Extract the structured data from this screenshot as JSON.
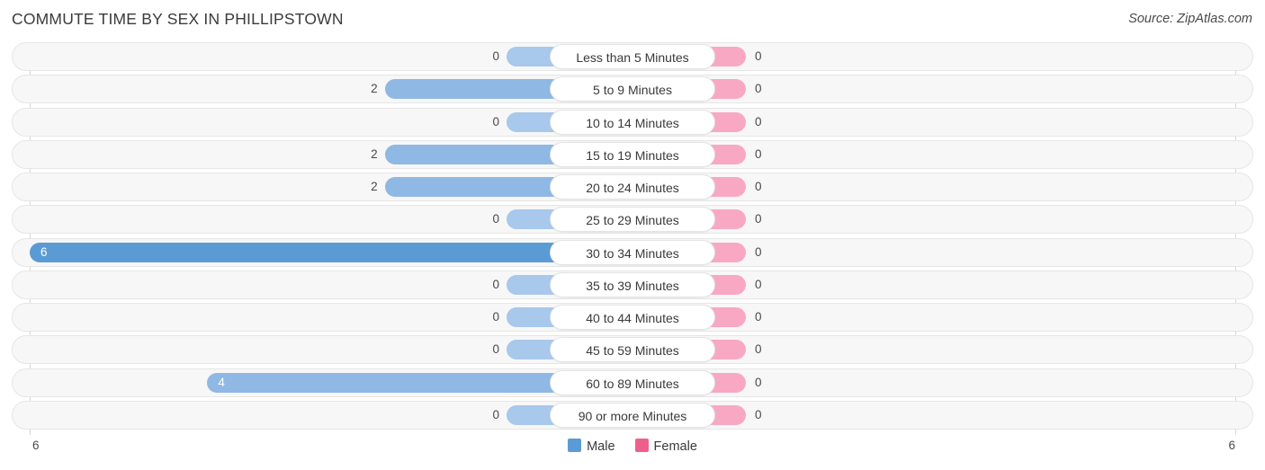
{
  "header": {
    "title": "COMMUTE TIME BY SEX IN PHILLIPSTOWN",
    "source": "Source: ZipAtlas.com"
  },
  "legend": {
    "items": [
      {
        "label": "Male",
        "color": "#5b9bd5"
      },
      {
        "label": "Female",
        "color": "#ef5f8b"
      }
    ]
  },
  "axis": {
    "left_tick": "6",
    "right_tick": "6"
  },
  "colors": {
    "male_pale": "#a8c8ec",
    "male_mid": "#8fb8e4",
    "male_max": "#5b9bd5",
    "female": "#f9a8c4",
    "track": "#f7f7f7",
    "track_border": "#e6e6e6"
  },
  "chart_data": {
    "type": "bar",
    "subtype": "diverging-bar",
    "title": "COMMUTE TIME BY SEX IN PHILLIPSTOWN",
    "xlabel": "",
    "ylabel": "",
    "xlim": [
      6,
      6
    ],
    "axis_max": 6,
    "grid": false,
    "legend_position": "bottom-center",
    "categories": [
      "Less than 5 Minutes",
      "5 to 9 Minutes",
      "10 to 14 Minutes",
      "15 to 19 Minutes",
      "20 to 24 Minutes",
      "25 to 29 Minutes",
      "30 to 34 Minutes",
      "35 to 39 Minutes",
      "40 to 44 Minutes",
      "45 to 59 Minutes",
      "60 to 89 Minutes",
      "90 or more Minutes"
    ],
    "series": [
      {
        "name": "Male",
        "side": "left",
        "values": [
          0,
          2,
          0,
          2,
          2,
          0,
          6,
          0,
          0,
          0,
          4,
          0
        ]
      },
      {
        "name": "Female",
        "side": "right",
        "values": [
          0,
          0,
          0,
          0,
          0,
          0,
          0,
          0,
          0,
          0,
          0,
          0
        ]
      }
    ]
  },
  "rows": [
    {
      "label": "Less than 5 Minutes",
      "male": "0",
      "female": "0"
    },
    {
      "label": "5 to 9 Minutes",
      "male": "2",
      "female": "0"
    },
    {
      "label": "10 to 14 Minutes",
      "male": "0",
      "female": "0"
    },
    {
      "label": "15 to 19 Minutes",
      "male": "2",
      "female": "0"
    },
    {
      "label": "20 to 24 Minutes",
      "male": "2",
      "female": "0"
    },
    {
      "label": "25 to 29 Minutes",
      "male": "0",
      "female": "0"
    },
    {
      "label": "30 to 34 Minutes",
      "male": "6",
      "female": "0"
    },
    {
      "label": "35 to 39 Minutes",
      "male": "0",
      "female": "0"
    },
    {
      "label": "40 to 44 Minutes",
      "male": "0",
      "female": "0"
    },
    {
      "label": "45 to 59 Minutes",
      "male": "0",
      "female": "0"
    },
    {
      "label": "60 to 89 Minutes",
      "male": "4",
      "female": "0"
    },
    {
      "label": "90 or more Minutes",
      "male": "0",
      "female": "0"
    }
  ]
}
